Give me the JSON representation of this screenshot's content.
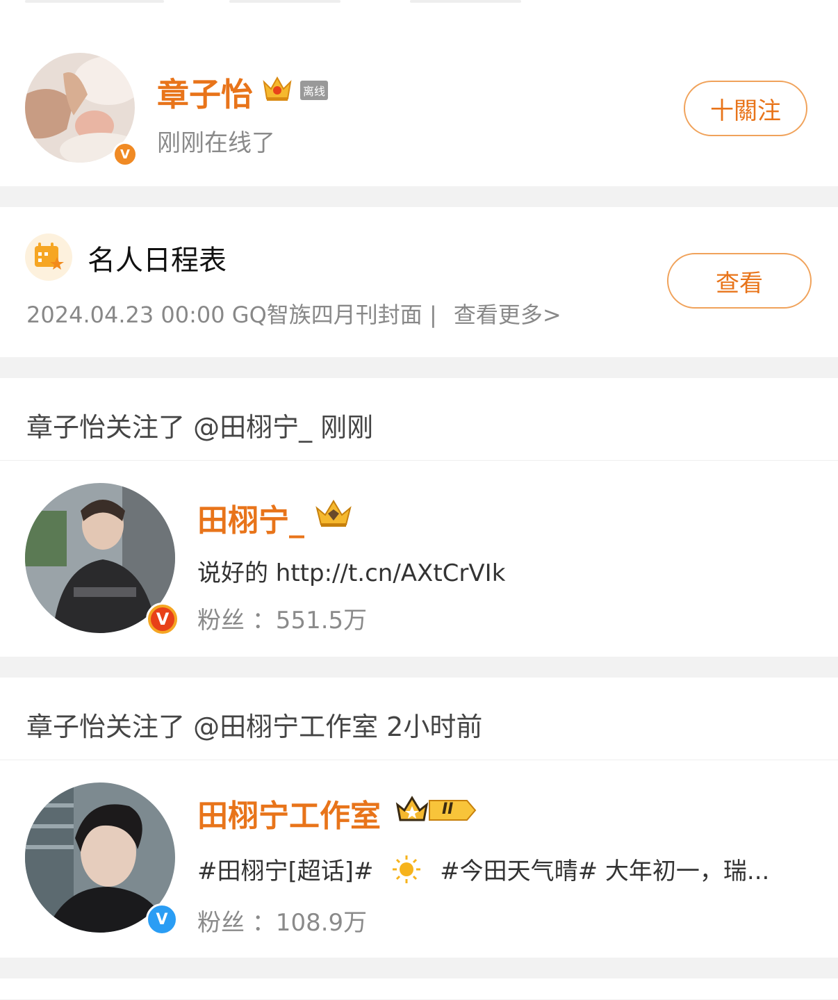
{
  "profile": {
    "name": "章子怡",
    "offline_tag": "离线",
    "status": "刚刚在线了",
    "follow_label": "十關注"
  },
  "schedule": {
    "title": "名人日程表",
    "info": "2024.04.23 00:00 GQ智族四月刊封面 |",
    "more": "查看更多>",
    "view_label": "查看"
  },
  "activities": [
    {
      "header": "章子怡关注了 @田栩宁_ 刚刚",
      "name": "田栩宁_",
      "desc": "说好的 http://t.cn/AXtCrVIk",
      "fans": "粉丝 ：551.5万",
      "verify_color": "#f5a623"
    },
    {
      "header": "章子怡关注了 @田栩宁工作室 2小时前",
      "name": "田栩宁工作室",
      "desc_a": "#田栩宁[超话]#",
      "desc_b": "#今田天气晴# 大年初一，瑞...",
      "fans": "粉丝 ：108.9万",
      "verify_color": "#2a9df4",
      "level_badge": "II"
    }
  ],
  "icons": {
    "crown": "crown-icon",
    "verified": "verified-icon",
    "calendar": "calendar-icon",
    "sun": "sun-icon"
  },
  "colors": {
    "accent": "#e8741a",
    "border_accent": "#f0a25a",
    "muted": "#8a8a8a"
  }
}
